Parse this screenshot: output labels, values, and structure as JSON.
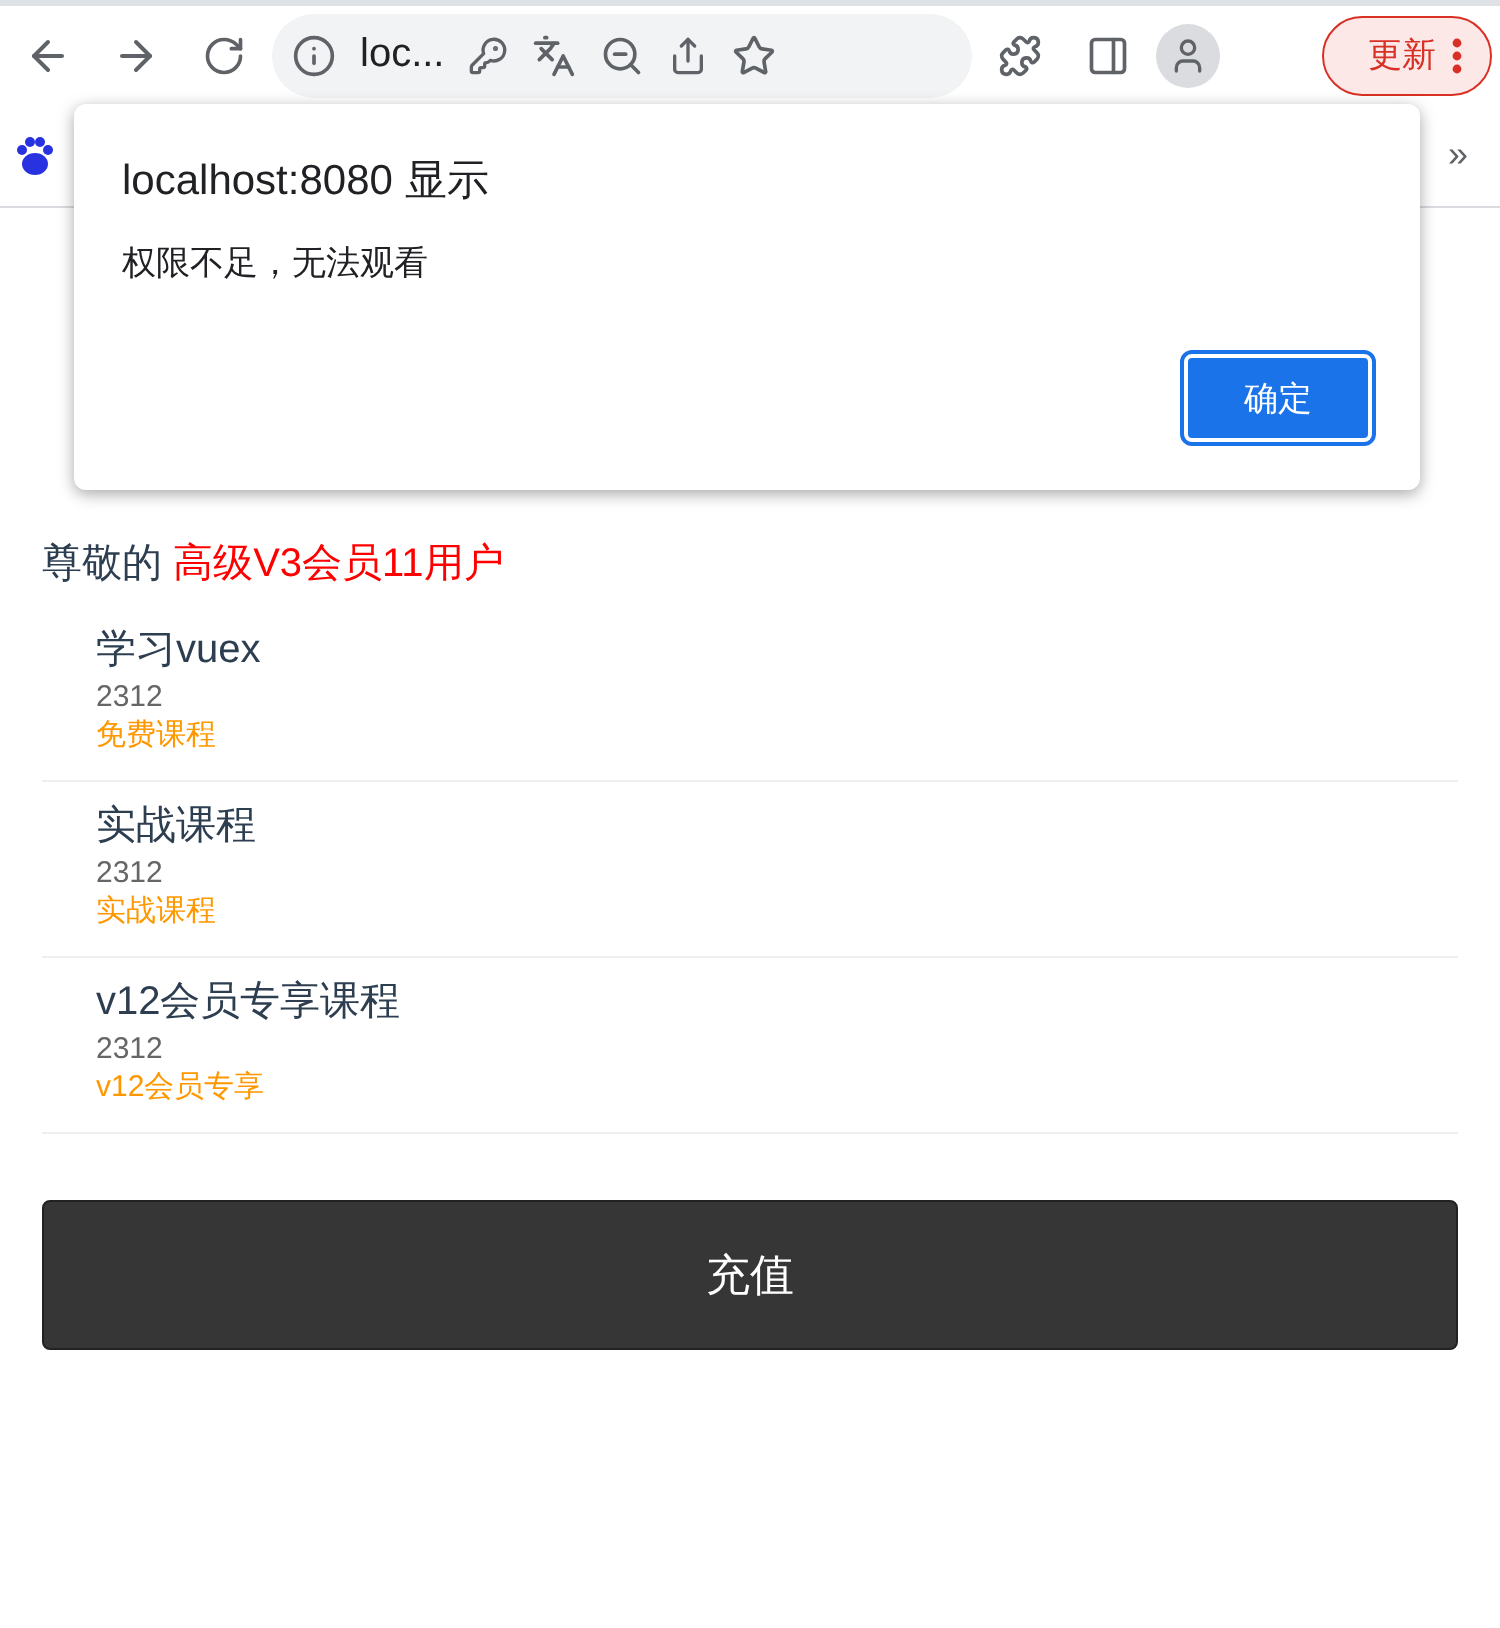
{
  "browser": {
    "address": "loc...",
    "update_button": "更新",
    "overflow": "»"
  },
  "dialog": {
    "title": "localhost:8080 显示",
    "message": "权限不足，无法观看",
    "ok_button": "确定"
  },
  "page": {
    "greeting": "尊敬的",
    "member_level": "高级V3会员11用户",
    "courses": [
      {
        "title": "学习vuex",
        "code": "2312",
        "tag": "免费课程"
      },
      {
        "title": "实战课程",
        "code": "2312",
        "tag": "实战课程"
      },
      {
        "title": "v12会员专享课程",
        "code": "2312",
        "tag": "v12会员专享"
      }
    ],
    "recharge_button": "充值"
  }
}
